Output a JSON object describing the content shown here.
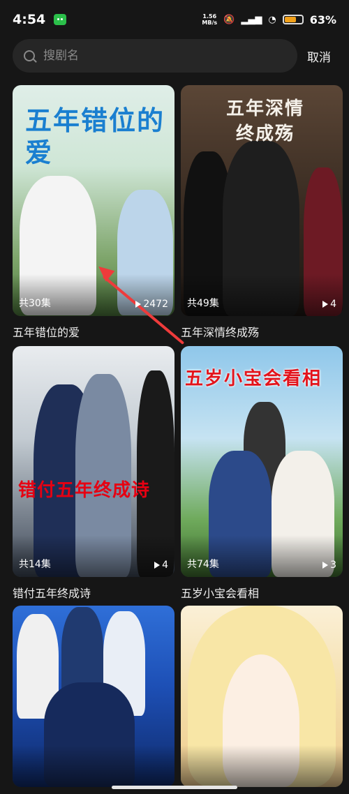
{
  "status_bar": {
    "time": "4:54",
    "net_speed_value": "1.56",
    "net_speed_unit": "MB/s",
    "battery_percent": "63%",
    "battery_level": 0.63
  },
  "search": {
    "placeholder": "搜剧名",
    "cancel_label": "取消"
  },
  "dramas": [
    {
      "title": "五年错位的爱",
      "episodes": "共30集",
      "plays": "2472",
      "poster_text": "五年错位的爱"
    },
    {
      "title": "五年深情终成殇",
      "episodes": "共49集",
      "plays": "4",
      "poster_text": "五年深情终成殇"
    },
    {
      "title": "错付五年终成诗",
      "episodes": "共14集",
      "plays": "4",
      "poster_text": "错付五年终成诗"
    },
    {
      "title": "五岁小宝会看相",
      "episodes": "共74集",
      "plays": "3",
      "poster_text": "五岁小宝会看相"
    },
    {
      "title": "",
      "episodes": "",
      "plays": "",
      "poster_text": ""
    },
    {
      "title": "",
      "episodes": "",
      "plays": "",
      "poster_text": ""
    }
  ],
  "colors": {
    "background": "#161616",
    "annotation_arrow": "#ee3b3b",
    "battery": "#f2a11a"
  }
}
